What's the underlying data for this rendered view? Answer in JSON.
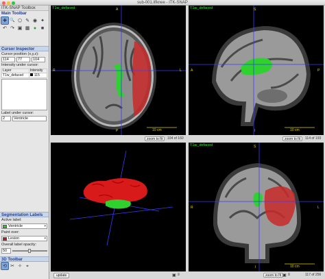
{
  "window_title": "sub-001.lifknee - ITK-SNAP",
  "toolbox": {
    "title": "ITK-SNAP Toolbox",
    "main_toolbar": "Main Toolbar",
    "tools": [
      "crosshair-icon",
      "zoom-icon",
      "polygon-icon",
      "paintbrush-icon",
      "snake-icon",
      "annotation-icon",
      "undo-icon",
      "redo-icon",
      "layers-icon",
      "image-icon",
      "color-circle-icon",
      "cube-icon"
    ],
    "tool_glyphs": [
      "✚",
      "🔍",
      "⬠",
      "✎",
      "◉",
      "✦",
      "↶",
      "↷",
      "▣",
      "▦",
      "●",
      "■"
    ]
  },
  "cursor_inspector": {
    "title": "Cursor Inspector",
    "position_label": "Cursor position (x,y,z):",
    "x": "114",
    "y": "77",
    "z": "104",
    "intensity_label": "Intensity under cursor:",
    "columns": [
      "Layer",
      "Intensity"
    ],
    "rows": [
      {
        "layer": "T1w_defaced",
        "intensity": "115"
      }
    ],
    "label_under_cursor": "Label under cursor:",
    "label_id": "2",
    "label_name": "Ventricle"
  },
  "segmentation": {
    "title": "Segmentation Labels",
    "active_label_caption": "Active label:",
    "active_label": "Ventricle",
    "active_color": "#22cc22",
    "paint_over_caption": "Paint over:",
    "paint_over": "Lesion",
    "paint_over_color": "#cc1111",
    "opacity_caption": "Overall label opacity:",
    "opacity": "50"
  },
  "toolbar_3d": {
    "title": "3D Toolbar",
    "tools": [
      "rotate-icon",
      "scalpel-icon",
      "spray-icon",
      "select-icon"
    ],
    "tool_glyphs": [
      "⟲",
      "✂",
      "✧",
      "⌖"
    ]
  },
  "views": {
    "axial": {
      "label": "T1w_defaced",
      "top": "A",
      "bottom": "P",
      "left": "R",
      "right": "L",
      "scale": "10 cm",
      "zoom": "zoom to fit",
      "slice": "104 of 160"
    },
    "sagittal": {
      "label": "T1w_defaced",
      "top": "S",
      "bottom": "I",
      "left": "A",
      "right": "P",
      "scale": "10 cm",
      "zoom": "zoom to fit",
      "slice": "114 of 193"
    },
    "render3d": {
      "update": "update"
    },
    "coronal": {
      "label": "T1w_defaced",
      "top": "S",
      "bottom": "I",
      "left": "R",
      "right": "L",
      "scale": "10 cm",
      "zoom": "zoom to fit",
      "slice": "117 of 256"
    }
  }
}
